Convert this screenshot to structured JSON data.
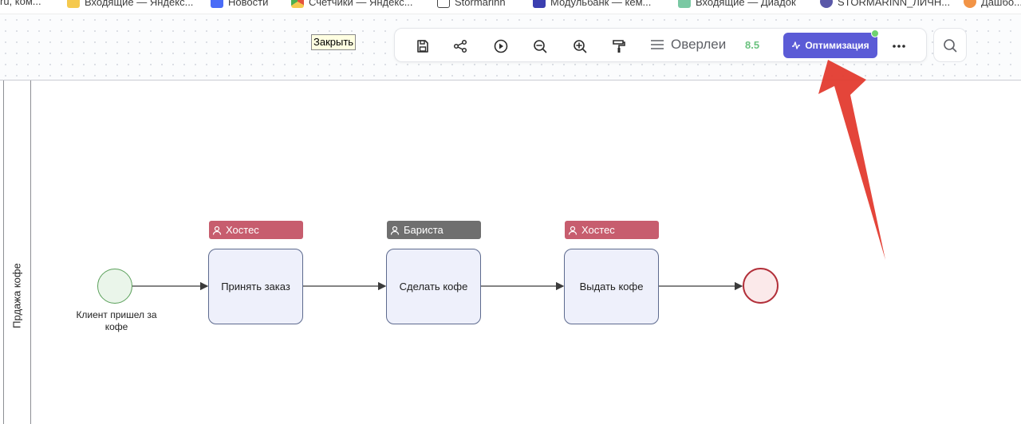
{
  "bookmarks": [
    {
      "label": "ru, ком...",
      "color": "#ffffff"
    },
    {
      "label": "Входящие — Яндекс...",
      "color": "#f5c94e"
    },
    {
      "label": "Новости",
      "color": "#4a6cf7"
    },
    {
      "label": "Счетчики — Яндекс...",
      "color": "#e5533d"
    },
    {
      "label": "Stormarinn",
      "color": "#ffffff"
    },
    {
      "label": "Модульбанк — кем...",
      "color": "#3b3fb0"
    },
    {
      "label": "Входящие — Диадок",
      "color": "#7ac8a3"
    },
    {
      "label": "STORMARINN_ЛИЧН...",
      "color": "#5a58a8"
    },
    {
      "label": "Дашбо...",
      "color": "#f29446"
    }
  ],
  "tooltip": {
    "text": "Закрыть"
  },
  "toolbar": {
    "icons": [
      "save-icon",
      "share-icon",
      "play-icon",
      "zoom-out-icon",
      "zoom-in-icon",
      "format-painter-icon"
    ],
    "overlay_label": "Оверлеи",
    "score": "8.5",
    "optimize_label": "Оптимизация",
    "colors": {
      "accent": "#5b5bd6",
      "status_dot": "#6ed26f",
      "score": "#6bc27f"
    }
  },
  "diagram": {
    "pool_label": "Прдажа кофе",
    "start_event_label": "Клиент пришел за кофе",
    "tasks": [
      {
        "label": "Принять заказ",
        "role": "Хостес",
        "role_color": "#c75d6e"
      },
      {
        "label": "Сделать кофе",
        "role": "Бариста",
        "role_color": "#6f6f6f"
      },
      {
        "label": "Выдать кофе",
        "role": "Хостес",
        "role_color": "#c75d6e"
      }
    ],
    "colors": {
      "start_fill": "#eaf5ea",
      "start_stroke": "#5aa05a",
      "end_fill": "#fbe9ea",
      "end_stroke": "#b2303a",
      "annotation_arrow": "#e33b2f"
    }
  }
}
